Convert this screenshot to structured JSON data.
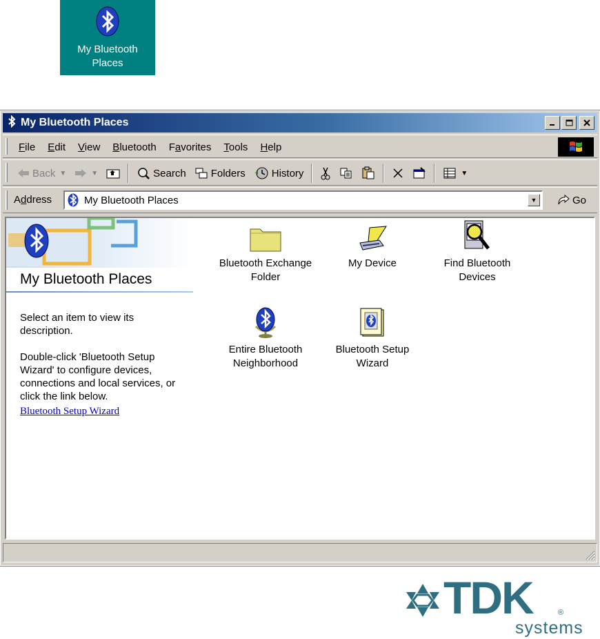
{
  "desktop_shortcut": {
    "label_line1": "My Bluetooth",
    "label_line2": "Places",
    "icon": "bluetooth-icon"
  },
  "window": {
    "title": "My Bluetooth Places",
    "controls": [
      "minimize",
      "maximize",
      "close"
    ]
  },
  "menubar": {
    "items": [
      {
        "label": "File",
        "key": "F",
        "rest": "ile"
      },
      {
        "label": "Edit",
        "key": "E",
        "rest": "dit"
      },
      {
        "label": "View",
        "key": "V",
        "rest": "iew"
      },
      {
        "label": "Bluetooth",
        "key": "B",
        "rest": "luetooth"
      },
      {
        "label": "Favorites",
        "pre": "F",
        "key": "a",
        "rest": "vorites"
      },
      {
        "label": "Tools",
        "key": "T",
        "rest": "ools"
      },
      {
        "label": "Help",
        "key": "H",
        "rest": "elp"
      }
    ]
  },
  "toolbar": {
    "back": "Back",
    "search": "Search",
    "folders": "Folders",
    "history": "History"
  },
  "address": {
    "label_pre": "A",
    "label_key": "d",
    "label_rest": "dress",
    "value": "My Bluetooth Places",
    "go": "Go"
  },
  "left_panel": {
    "title": "My Bluetooth Places",
    "desc1": "Select an item to view its description.",
    "desc2": "Double-click 'Bluetooth Setup Wizard' to configure devices, connections and local services, or click the link below.",
    "link": "Bluetooth Setup Wizard"
  },
  "items": [
    {
      "line1": "Bluetooth Exchange",
      "line2": "Folder",
      "icon": "folder-icon"
    },
    {
      "line1": "My Device",
      "line2": "",
      "icon": "laptop-icon"
    },
    {
      "line1": "Find Bluetooth",
      "line2": "Devices",
      "icon": "find-devices-icon"
    },
    {
      "line1": "Entire Bluetooth",
      "line2": "Neighborhood",
      "icon": "globe-icon"
    },
    {
      "line1": "Bluetooth Setup",
      "line2": "Wizard",
      "icon": "wizard-book-icon"
    }
  ],
  "branding": {
    "brand": "TDK",
    "sub": "systems",
    "reg": "®"
  },
  "colors": {
    "desktop_teal": "#008080",
    "title_blue": "#0a246a",
    "window_gray": "#d4d0c8",
    "bluetooth_blue": "#1f3fbf",
    "tdk_teal": "#2e6e80",
    "link_blue": "#0000cc"
  }
}
